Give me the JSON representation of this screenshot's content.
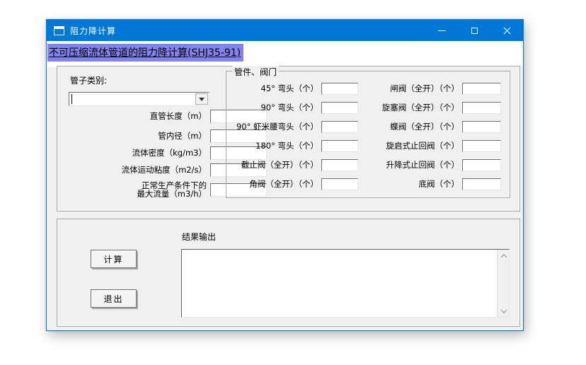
{
  "window": {
    "title": "阻力降计算",
    "icons": {
      "app": "form-icon",
      "minimize": "minimize-icon",
      "maximize": "maximize-icon",
      "close": "close-icon"
    }
  },
  "heading": {
    "text": "不可压缩流体管道的阻力降计算(SHJ35-91)"
  },
  "pipe": {
    "category_label": "管子类别:",
    "category_value": "",
    "fields": [
      {
        "label": "直管长度（m）",
        "value": ""
      },
      {
        "label": "管内径（m）",
        "value": ""
      },
      {
        "label": "流体密度（kg/m3）",
        "value": ""
      },
      {
        "label": "流体运动粘度（m2/s）",
        "value": ""
      },
      {
        "label": "正常生产条件下的\n最大流量（m3/h）",
        "value": ""
      }
    ]
  },
  "fittings": {
    "title": "管件、阀门",
    "left": [
      {
        "label": "45° 弯头（个）",
        "value": ""
      },
      {
        "label": "90° 弯头（个）",
        "value": ""
      },
      {
        "label": "90° 虾米腰弯头（个）",
        "value": ""
      },
      {
        "label": "180° 弯头（个）",
        "value": ""
      },
      {
        "label": "截止阀（全开）（个）",
        "value": ""
      },
      {
        "label": "角阀（全开）（个）",
        "value": ""
      }
    ],
    "right": [
      {
        "label": "闸阀（全开）（个）",
        "value": ""
      },
      {
        "label": "旋塞阀（全开）（个）",
        "value": ""
      },
      {
        "label": "蝶阀（全开）（个）",
        "value": ""
      },
      {
        "label": "旋启式止回阀（个）",
        "value": ""
      },
      {
        "label": "升降式止回阀（个）",
        "value": ""
      },
      {
        "label": "底阀（个）",
        "value": ""
      }
    ]
  },
  "actions": {
    "calculate": "计算",
    "exit": "退出"
  },
  "output": {
    "label": "结果输出",
    "value": ""
  },
  "colors": {
    "titlebar": "#0078D7",
    "heading_highlight": "#8383EE",
    "panel": "#F0F0F0"
  }
}
